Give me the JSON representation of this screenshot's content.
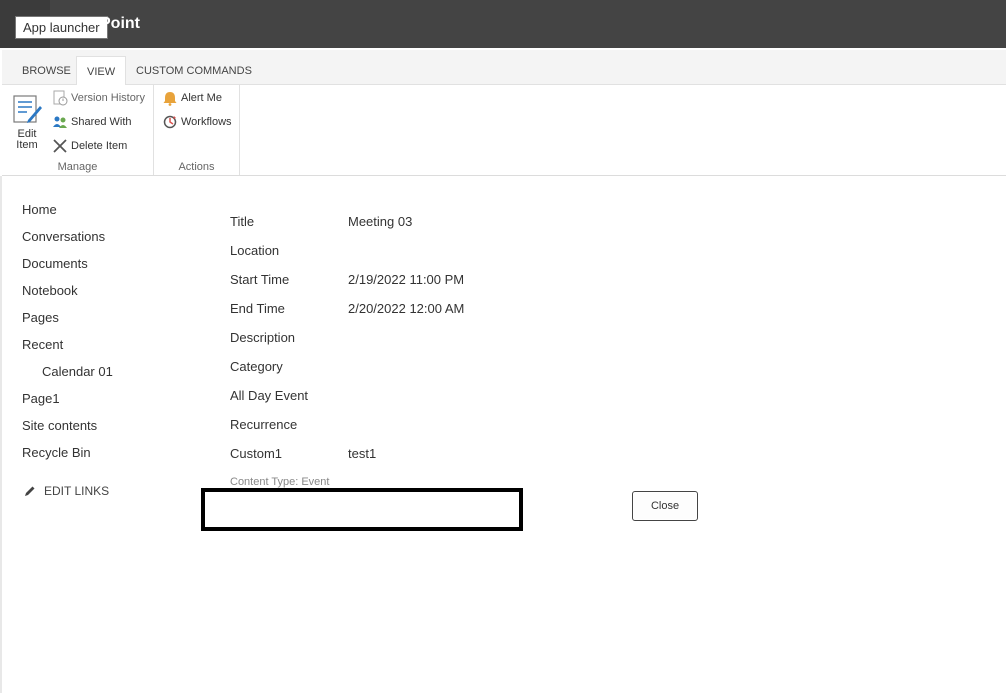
{
  "suitebar": {
    "app_launcher_tooltip": "App launcher",
    "brand_partial": "Point"
  },
  "ribbon": {
    "tabs": [
      {
        "label": "BROWSE",
        "active": false
      },
      {
        "label": "VIEW",
        "active": true
      },
      {
        "label": "CUSTOM COMMANDS",
        "active": false
      }
    ],
    "manage": {
      "edit_item_line1": "Edit",
      "edit_item_line2": "Item",
      "version_history": "Version History",
      "shared_with": "Shared With",
      "delete_item": "Delete Item",
      "group_label": "Manage"
    },
    "actions": {
      "alert_me": "Alert Me",
      "workflows": "Workflows",
      "group_label": "Actions"
    }
  },
  "leftnav": {
    "items": [
      {
        "label": "Home"
      },
      {
        "label": "Conversations"
      },
      {
        "label": "Documents"
      },
      {
        "label": "Notebook"
      },
      {
        "label": "Pages"
      },
      {
        "label": "Recent"
      },
      {
        "label": "Calendar 01"
      },
      {
        "label": "Page1"
      },
      {
        "label": "Site contents"
      },
      {
        "label": "Recycle Bin"
      }
    ],
    "edit_links": "EDIT LINKS"
  },
  "form": {
    "fields": [
      {
        "label": "Title",
        "value": "Meeting 03"
      },
      {
        "label": "Location",
        "value": ""
      },
      {
        "label": "Start Time",
        "value": "2/19/2022 11:00 PM"
      },
      {
        "label": "End Time",
        "value": "2/20/2022 12:00 AM"
      },
      {
        "label": "Description",
        "value": ""
      },
      {
        "label": "Category",
        "value": ""
      },
      {
        "label": "All Day Event",
        "value": ""
      },
      {
        "label": "Recurrence",
        "value": ""
      },
      {
        "label": "Custom1",
        "value": "test1"
      }
    ],
    "content_type": "Content Type: Event",
    "close_label": "Close"
  },
  "colors": {
    "suitebar": "#444444",
    "accent_orange": "#e8a33b",
    "accent_blue": "#2b78c4"
  }
}
